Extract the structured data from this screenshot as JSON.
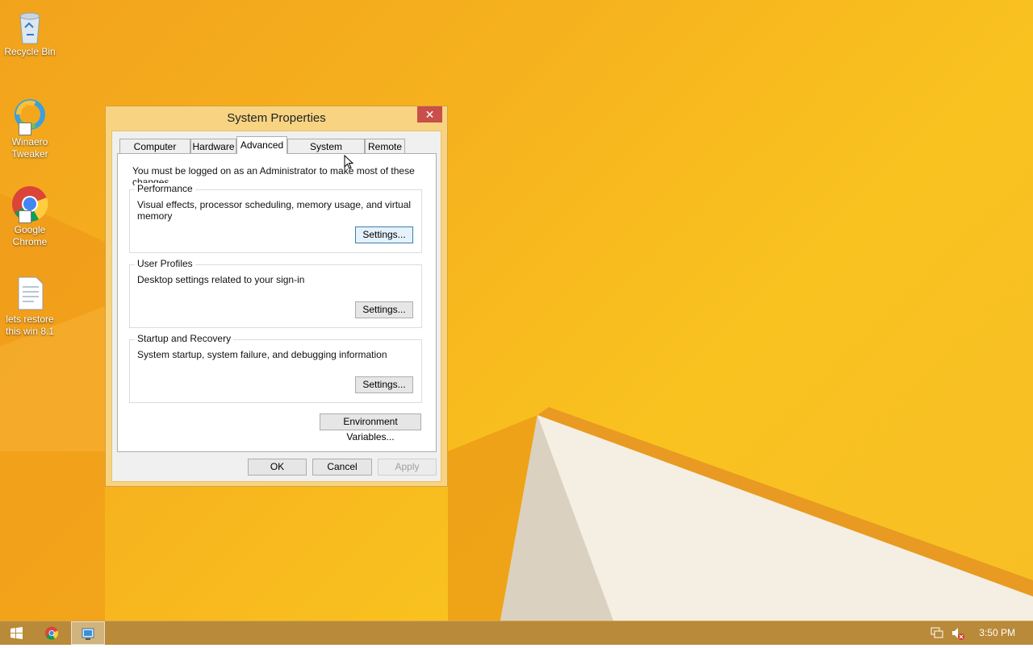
{
  "desktop": {
    "icons": [
      {
        "label": "Recycle Bin",
        "icon": "recycle-bin-icon"
      },
      {
        "label": "Winaero Tweaker",
        "icon": "winaero-tweaker-icon"
      },
      {
        "label": "Google Chrome",
        "icon": "chrome-icon"
      },
      {
        "label": "lets restore this win 8.1",
        "icon": "text-file-icon"
      }
    ]
  },
  "dialog": {
    "title": "System Properties",
    "close_symbol": "✕",
    "tabs": [
      {
        "label": "Computer Name"
      },
      {
        "label": "Hardware"
      },
      {
        "label": "Advanced",
        "active": true
      },
      {
        "label": "System Protection"
      },
      {
        "label": "Remote"
      }
    ],
    "note": "You must be logged on as an Administrator to make most of these changes.",
    "groups": [
      {
        "title": "Performance",
        "description": "Visual effects, processor scheduling, memory usage, and virtual memory",
        "button": "Settings..."
      },
      {
        "title": "User Profiles",
        "description": "Desktop settings related to your sign-in",
        "button": "Settings..."
      },
      {
        "title": "Startup and Recovery",
        "description": "System startup, system failure, and debugging information",
        "button": "Settings..."
      }
    ],
    "env_button": "Environment Variables...",
    "buttons": {
      "ok": "OK",
      "cancel": "Cancel",
      "apply": "Apply"
    }
  },
  "taskbar": {
    "clock": "3:50 PM",
    "items": [
      "start-button",
      "chrome-taskbar",
      "system-properties-taskbar"
    ]
  },
  "colors": {
    "accent": "#f6b21e",
    "close": "#c7504a",
    "taskbar": "#b98a3a"
  }
}
